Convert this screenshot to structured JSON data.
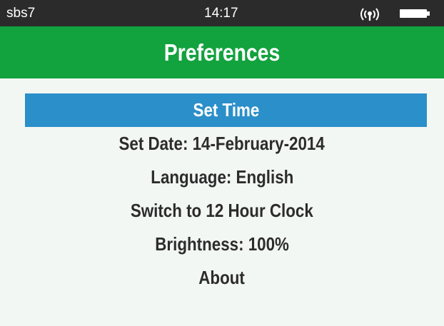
{
  "status_bar": {
    "carrier": "sbs7",
    "time": "14:17",
    "signal_icon": "wireless-signal-icon",
    "battery_icon": "battery-full-icon"
  },
  "header": {
    "title": "Preferences"
  },
  "menu": {
    "items": [
      {
        "label": "Set Time",
        "selected": true
      },
      {
        "label": "Set Date: 14-February-2014",
        "selected": false
      },
      {
        "label": "Language: English",
        "selected": false
      },
      {
        "label": "Switch to 12 Hour Clock",
        "selected": false
      },
      {
        "label": "Brightness: 100%",
        "selected": false
      },
      {
        "label": "About",
        "selected": false
      }
    ]
  },
  "colors": {
    "status_bar_bg": "#2b2b2b",
    "title_bar_bg": "#12a23e",
    "selected_bg": "#2b8fc9",
    "screen_bg": "#f3f7f4",
    "item_text": "#2c2c2c"
  }
}
